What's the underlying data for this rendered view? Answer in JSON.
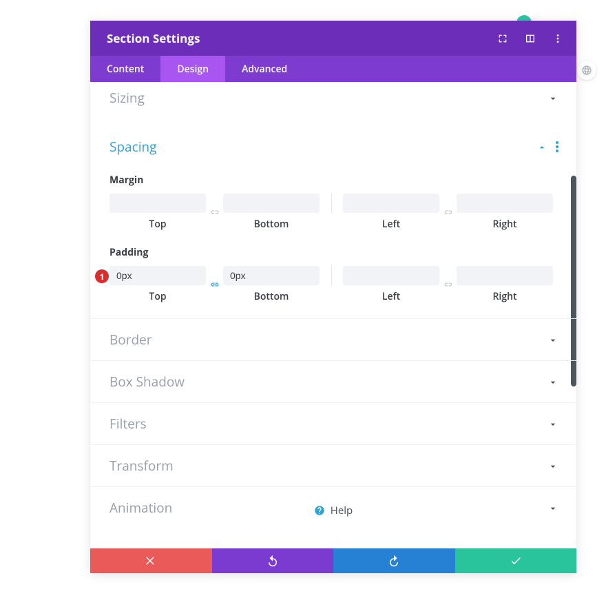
{
  "header": {
    "title": "Section Settings"
  },
  "tabs": {
    "content": "Content",
    "design": "Design",
    "advanced": "Advanced",
    "active": "Design"
  },
  "sections": {
    "sizing": "Sizing",
    "spacing": "Spacing",
    "border": "Border",
    "boxshadow": "Box Shadow",
    "filters": "Filters",
    "transform": "Transform",
    "animation": "Animation"
  },
  "spacing": {
    "margin": {
      "label": "Margin",
      "top": {
        "value": "",
        "label": "Top"
      },
      "bottom": {
        "value": "",
        "label": "Bottom"
      },
      "left": {
        "value": "",
        "label": "Left"
      },
      "right": {
        "value": "",
        "label": "Right"
      },
      "link_tb": false,
      "link_lr": false
    },
    "padding": {
      "label": "Padding",
      "top": {
        "value": "0px",
        "label": "Top"
      },
      "bottom": {
        "value": "0px",
        "label": "Bottom"
      },
      "left": {
        "value": "",
        "label": "Left"
      },
      "right": {
        "value": "",
        "label": "Right"
      },
      "link_tb": true,
      "link_lr": false
    }
  },
  "annotation": {
    "badge1": "1"
  },
  "help": {
    "label": "Help"
  },
  "colors": {
    "header": "#6c2eb9",
    "tabsbar": "#7e3bd0",
    "tab_active": "#a855f2",
    "accent_blue": "#2ea3d6",
    "cancel": "#ea5a58",
    "undo": "#7c3bd0",
    "redo": "#2680d4",
    "save": "#29c49b",
    "annot": "#d72f2f"
  }
}
